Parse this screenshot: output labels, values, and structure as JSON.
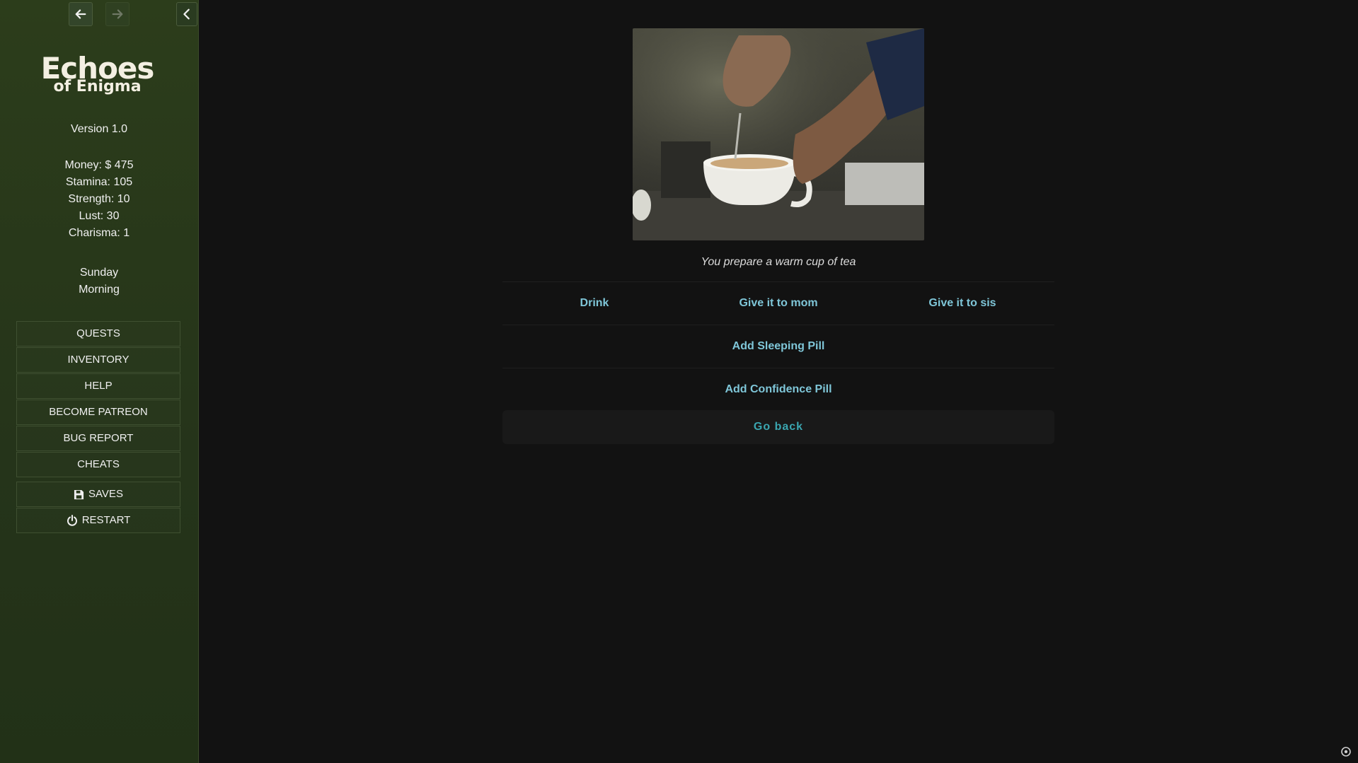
{
  "sidebar": {
    "logo_line1": "Echoes",
    "logo_line2": "of Enigma",
    "version": "Version 1.0",
    "stats": [
      "Money: $ 475",
      "Stamina: 105",
      "Strength: 10",
      "Lust: 30",
      "Charisma: 1"
    ],
    "day": "Sunday",
    "time_of_day": "Morning",
    "menu": [
      "QUESTS",
      "INVENTORY",
      "HELP",
      "BECOME PATREON",
      "BUG REPORT",
      "CHEATS"
    ],
    "saves_label": "SAVES",
    "restart_label": "RESTART"
  },
  "icons": {
    "back": "arrow-left-icon",
    "forward": "arrow-right-icon",
    "collapse": "chevron-left-icon",
    "saves": "floppy-disk-icon",
    "restart": "power-icon",
    "corner": "settings-icon"
  },
  "main": {
    "caption": "You prepare a warm cup of tea",
    "choices_row1": [
      "Drink",
      "Give it to mom",
      "Give it to sis"
    ],
    "choice_sleeping": "Add Sleeping Pill",
    "choice_confidence": "Add Confidence Pill",
    "go_back": "Go back"
  },
  "colors": {
    "sidebar_bg": "#26361a",
    "main_bg": "#121212",
    "choice_text": "#7fc6d8",
    "go_back_text": "#3aa6b0"
  }
}
